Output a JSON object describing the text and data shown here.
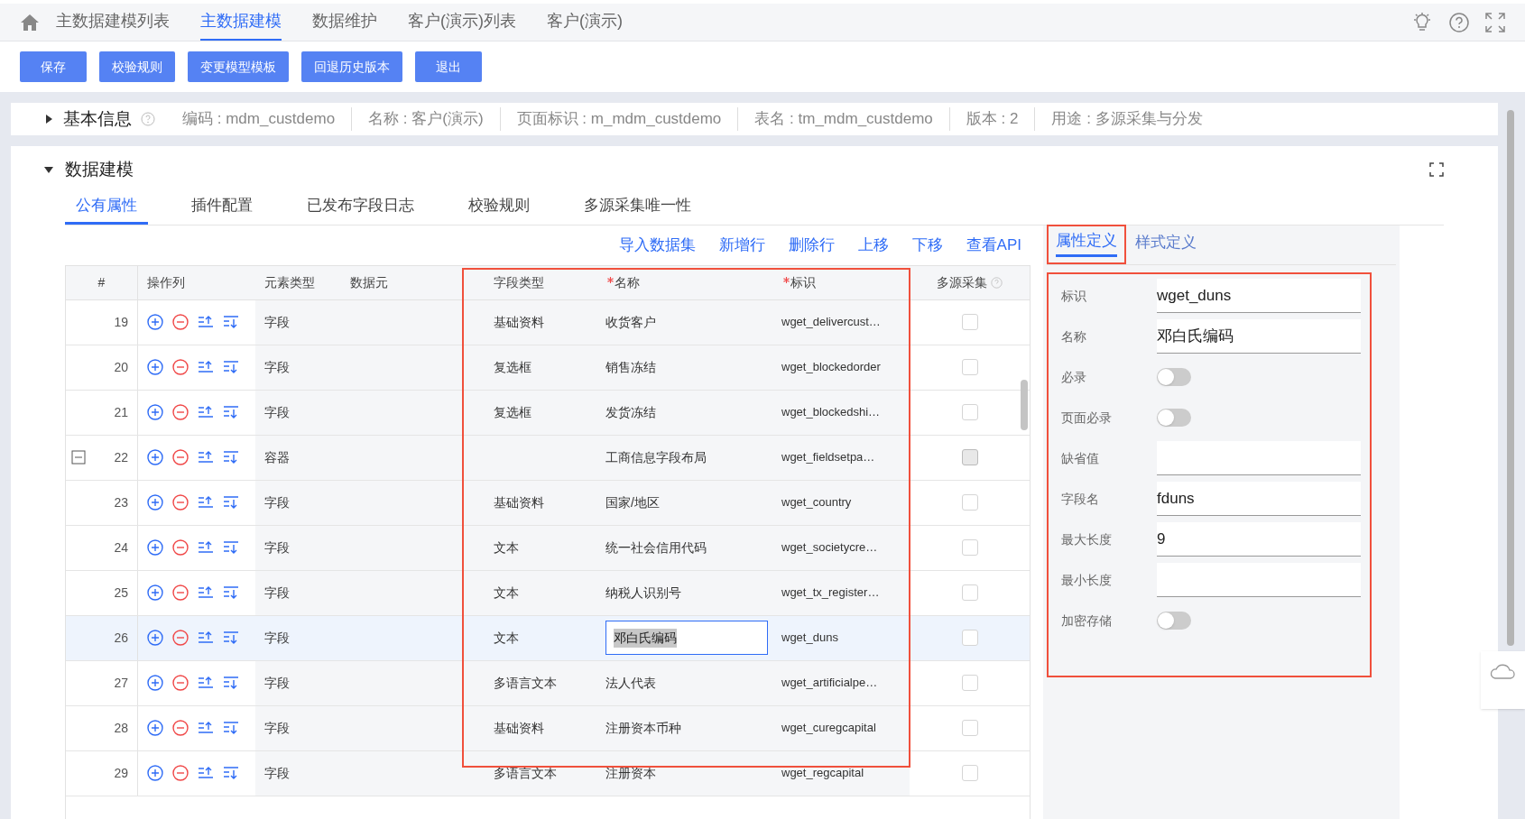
{
  "nav": {
    "tabs": [
      {
        "label": "主数据建模列表",
        "selected": false
      },
      {
        "label": "主数据建模",
        "selected": true
      },
      {
        "label": "数据维护",
        "selected": false
      },
      {
        "label": "客户(演示)列表",
        "selected": false
      },
      {
        "label": "客户(演示)",
        "selected": false
      }
    ]
  },
  "toolbar": {
    "buttons": [
      "保存",
      "校验规则",
      "变更模型模板",
      "回退历史版本",
      "退出"
    ]
  },
  "basic_info": {
    "title": "基本信息",
    "expanded": false,
    "fields": [
      "编码 : mdm_custdemo",
      "名称 : 客户(演示)",
      "页面标识 : m_mdm_custdemo",
      "表名 : tm_mdm_custdemo",
      "版本 : 2",
      "用途 : 多源采集与分发"
    ]
  },
  "modeling": {
    "title": "数据建模",
    "expanded": true,
    "tabs": [
      {
        "label": "公有属性",
        "selected": true
      },
      {
        "label": "插件配置",
        "selected": false
      },
      {
        "label": "已发布字段日志",
        "selected": false
      },
      {
        "label": "校验规则",
        "selected": false
      },
      {
        "label": "多源采集唯一性",
        "selected": false
      }
    ],
    "actions": [
      "导入数据集",
      "新增行",
      "删除行",
      "上移",
      "下移",
      "查看API"
    ],
    "table": {
      "columns": [
        {
          "label": "#",
          "required": false
        },
        {
          "label": "操作列",
          "required": false
        },
        {
          "label": "元素类型",
          "required": false
        },
        {
          "label": "数据元",
          "required": false
        },
        {
          "label": "字段类型",
          "required": false
        },
        {
          "label": "名称",
          "required": true
        },
        {
          "label": "标识",
          "required": true
        },
        {
          "label": "多源采集",
          "required": false
        }
      ],
      "rows": [
        {
          "index": "19",
          "element_type": "字段",
          "field_type": "基础资料",
          "name": "收货客户",
          "key": "wget_delivercust…",
          "selected": false,
          "editing": false,
          "multi_source": false,
          "multi_source_disabled": false
        },
        {
          "index": "20",
          "element_type": "字段",
          "field_type": "复选框",
          "name": "销售冻结",
          "key": "wget_blockedorder",
          "selected": false,
          "editing": false,
          "multi_source": false,
          "multi_source_disabled": false
        },
        {
          "index": "21",
          "element_type": "字段",
          "field_type": "复选框",
          "name": "发货冻结",
          "key": "wget_blockedshi…",
          "selected": false,
          "editing": false,
          "multi_source": false,
          "multi_source_disabled": false
        },
        {
          "index": "22",
          "expanded": true,
          "element_type": "容器",
          "name": "工商信息字段布局",
          "key": "wget_fieldsetpa…",
          "selected": false,
          "editing": false,
          "multi_source": false,
          "multi_source_disabled": true
        },
        {
          "index": "23",
          "element_type": "字段",
          "field_type": "基础资料",
          "name": "国家/地区",
          "key": "wget_country",
          "selected": false,
          "editing": false,
          "multi_source": false,
          "multi_source_disabled": false
        },
        {
          "index": "24",
          "element_type": "字段",
          "field_type": "文本",
          "name": "统一社会信用代码",
          "key": "wget_societycre…",
          "selected": false,
          "editing": false,
          "multi_source": false,
          "multi_source_disabled": false
        },
        {
          "index": "25",
          "element_type": "字段",
          "field_type": "文本",
          "name": "纳税人识别号",
          "key": "wget_tx_register…",
          "selected": false,
          "editing": false,
          "multi_source": false,
          "multi_source_disabled": false
        },
        {
          "index": "26",
          "element_type": "字段",
          "field_type": "文本",
          "name": "邓白氏编码",
          "key": "wget_duns",
          "selected": true,
          "editing": true,
          "multi_source": false,
          "multi_source_disabled": false
        },
        {
          "index": "27",
          "element_type": "字段",
          "field_type": "多语言文本",
          "name": "法人代表",
          "key": "wget_artificialpe…",
          "selected": false,
          "editing": false,
          "multi_source": false,
          "multi_source_disabled": false
        },
        {
          "index": "28",
          "element_type": "字段",
          "field_type": "基础资料",
          "name": "注册资本币种",
          "key": "wget_curegcapital",
          "selected": false,
          "editing": false,
          "multi_source": false,
          "multi_source_disabled": false
        },
        {
          "index": "29",
          "element_type": "字段",
          "field_type": "多语言文本",
          "name": "注册资本",
          "key": "wget_regcapital",
          "selected": false,
          "editing": false,
          "multi_source": false,
          "multi_source_disabled": false
        }
      ]
    },
    "properties": {
      "tabs": [
        {
          "label": "属性定义",
          "selected": true
        },
        {
          "label": "样式定义",
          "selected": false
        }
      ],
      "fields": [
        {
          "kind": "input",
          "label": "标识",
          "value": "wget_duns"
        },
        {
          "kind": "input",
          "label": "名称",
          "value": "邓白氏编码"
        },
        {
          "kind": "switch",
          "label": "必录",
          "on": false
        },
        {
          "kind": "switch",
          "label": "页面必录",
          "on": false
        },
        {
          "kind": "input",
          "label": "缺省值"
        },
        {
          "kind": "input",
          "label": "字段名",
          "value": "fduns"
        },
        {
          "kind": "input",
          "label": "最大长度",
          "value": "9"
        },
        {
          "kind": "input",
          "label": "最小长度"
        },
        {
          "kind": "switch",
          "label": "加密存储",
          "on": false
        }
      ]
    }
  }
}
